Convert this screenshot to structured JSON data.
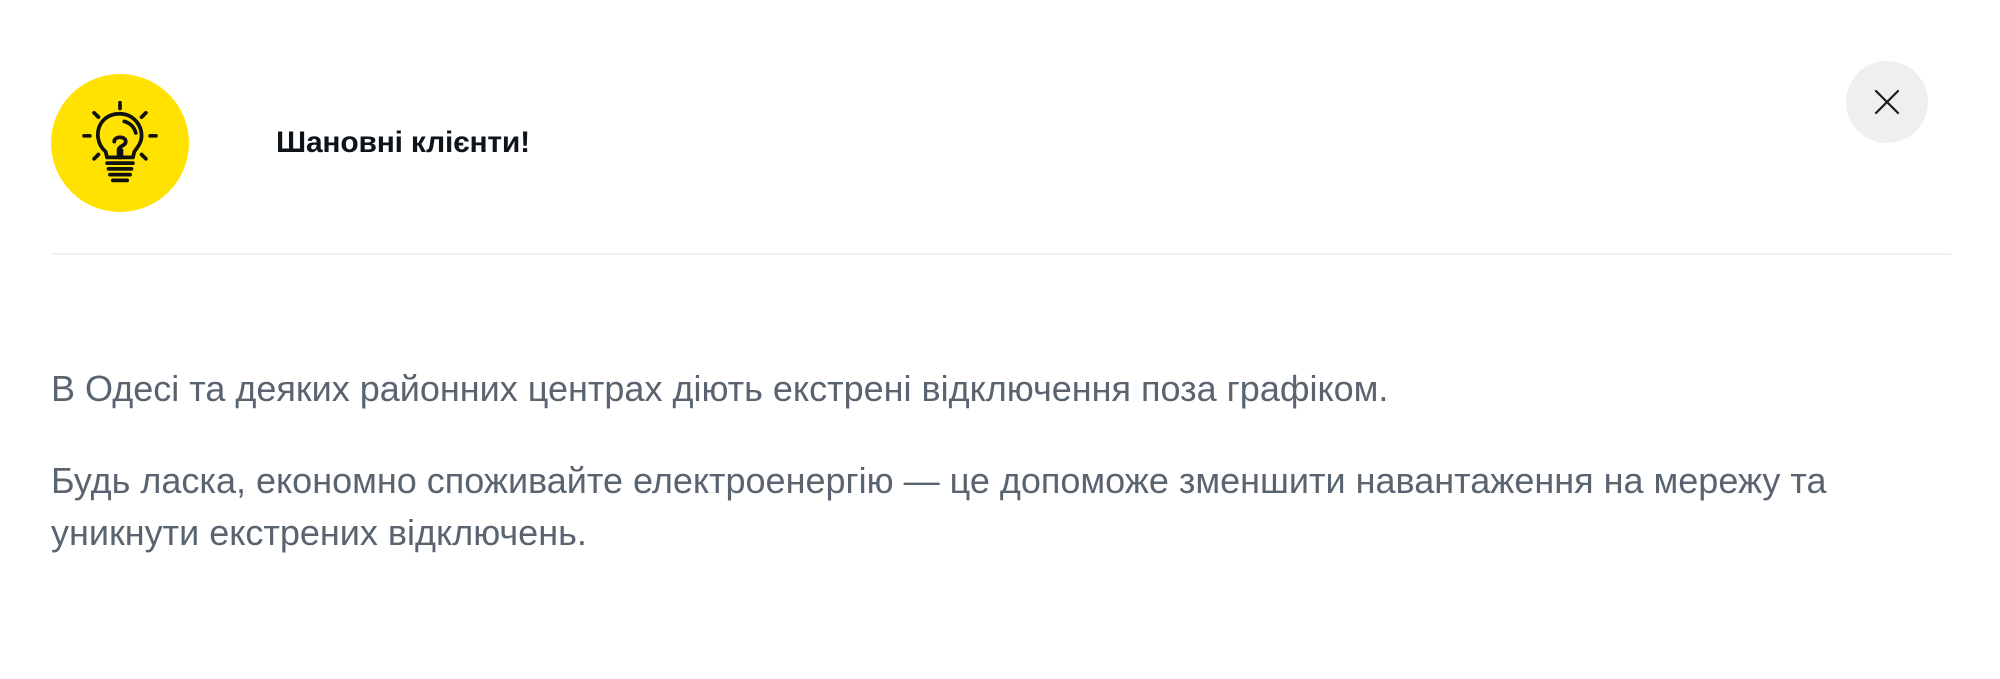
{
  "notice": {
    "icon": "lightbulb-icon",
    "accent_color": "#ffe200",
    "title": "Шановні клієнти!",
    "close_icon": "close-icon",
    "paragraphs": [
      "В Одесі та деяких районних центрах діють екстрені відключення поза графіком.",
      "Будь ласка, економно споживайте електроенергію — це допоможе зменшити навантаження на мережу та уникнути екстрених відключень."
    ]
  }
}
